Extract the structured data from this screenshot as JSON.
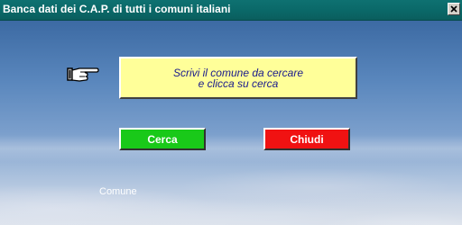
{
  "window": {
    "title": "Banca dati dei C.A.P. di tutti i comuni italiani",
    "close_label": "Close"
  },
  "icons": {
    "pointer": "pointing-hand-icon",
    "close": "close-icon"
  },
  "message": {
    "line1": "Scrivi il comune da cercare",
    "line2": "e clicca su cerca"
  },
  "buttons": {
    "search_label": "Cerca",
    "close_label": "Chiudi"
  },
  "fields": {
    "comune_label": "Comune"
  },
  "colors": {
    "title_bar": "#0a6868",
    "message_bg": "#ffff99",
    "message_text": "#1a1a8c",
    "search_button": "#19c919",
    "close_button": "#f01212"
  }
}
